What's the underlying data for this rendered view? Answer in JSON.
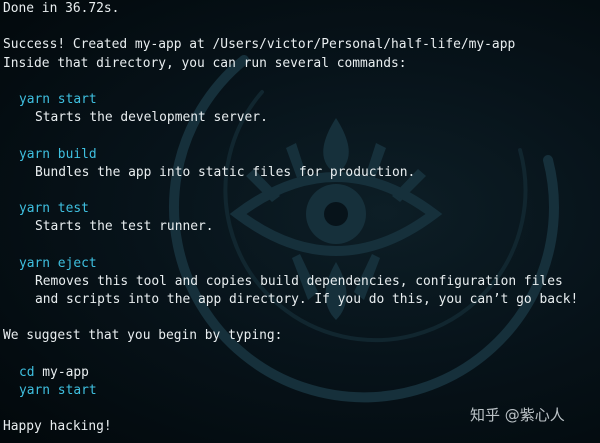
{
  "terminal": {
    "status_line": "Done in 36.72s.",
    "success_line": "Success! Created my-app at /Users/victor/Personal/half-life/my-app",
    "inside_line": "Inside that directory, you can run several commands:",
    "commands": [
      {
        "command": "yarn start",
        "description": [
          "Starts the development server."
        ]
      },
      {
        "command": "yarn build",
        "description": [
          "Bundles the app into static files for production."
        ]
      },
      {
        "command": "yarn test",
        "description": [
          "Starts the test runner."
        ]
      },
      {
        "command": "yarn eject",
        "description": [
          "Removes this tool and copies build dependencies, configuration files",
          "and scripts into the app directory. If you do this, you can’t go back!"
        ]
      }
    ],
    "suggest_line": "We suggest that you begin by typing:",
    "suggest_cd_command": "cd",
    "suggest_cd_arg": " my-app",
    "suggest_start_command": "yarn start",
    "closing_line": "Happy hacking!"
  },
  "watermark": {
    "text": "知乎 @紫心人"
  },
  "colors": {
    "background": "#07131a",
    "text": "#e9eef0",
    "command": "#3fc0e0",
    "emblem": "#16303b"
  },
  "icons": {
    "background_emblem": "sheikah-eye-icon"
  }
}
